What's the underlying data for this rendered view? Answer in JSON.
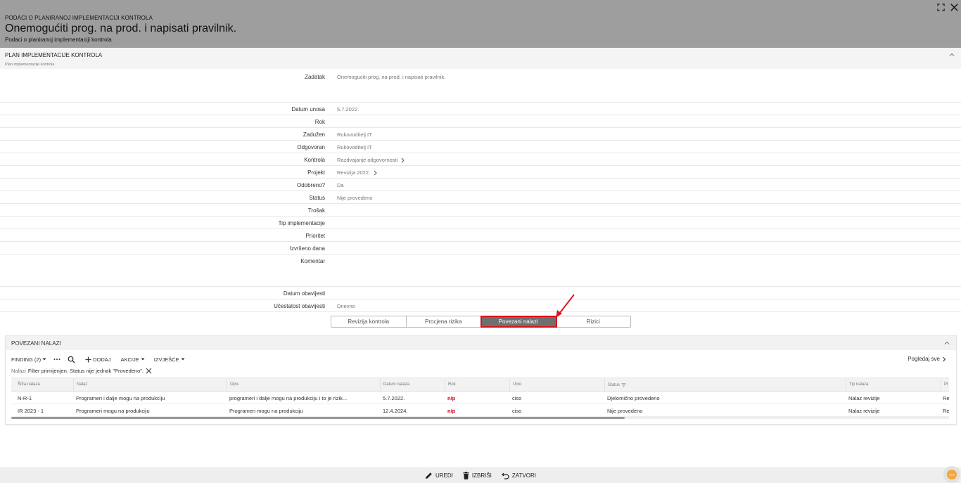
{
  "header": {
    "crumb": "PODACI O PLANIRANOJ IMPLEMENTACIJI KONTROLA",
    "title": "Onemogućiti prog. na prod. i napisati pravilnik.",
    "subtitle": "Podaci o planiranoj implementaciji kontrola"
  },
  "section": {
    "title": "PLAN IMPLEMENTACIJE KONTROLA",
    "subtitle": "Plan implementacije kontrola"
  },
  "form": {
    "fields": [
      {
        "label": "Zadatak",
        "value": "Onemogućiti prog. na prod. i napisati pravilnik."
      },
      {
        "label": "Datum unosa",
        "value": "5.7.2022."
      },
      {
        "label": "Rok",
        "value": ""
      },
      {
        "label": "Zadužen",
        "value": "Rukovoditelj IT"
      },
      {
        "label": "Odgovoran",
        "value": "Rukovoditelj IT"
      },
      {
        "label": "Kontrola",
        "value": "Razdvajanje odgovornosti"
      },
      {
        "label": "Projekt",
        "value": "Revizija 2022."
      },
      {
        "label": "Odobreno?",
        "value": "Da"
      },
      {
        "label": "Status",
        "value": "Nije provedeno"
      },
      {
        "label": "Trošak",
        "value": ""
      },
      {
        "label": "Tip implementacije",
        "value": ""
      },
      {
        "label": "Prioritet",
        "value": ""
      },
      {
        "label": "Izvršeno dana",
        "value": ""
      },
      {
        "label": "Komentar",
        "value": ""
      },
      {
        "label": "Datum obavijesti",
        "value": ""
      },
      {
        "label": "Učestalost obavijesti",
        "value": "Dnevno"
      }
    ]
  },
  "tabs": [
    {
      "label": "Revizija kontrola"
    },
    {
      "label": "Procjena rizika"
    },
    {
      "label": "Povezani nalazi",
      "active": true
    },
    {
      "label": "Rizici"
    }
  ],
  "panel": {
    "title": "POVEZANI NALAZI",
    "toolbar": {
      "finding": "FINDING (2)",
      "add": "DODAJ",
      "actions": "AKCIJE",
      "reports": "IZVJEŠĆE"
    },
    "view_all": "Pogledaj sve",
    "filter": {
      "prefix": "Nalazi",
      "text": "Filter primijenjen. Status nije jednak \"Provedeno\"."
    },
    "columns": [
      "Šifra nalaza",
      "Nalaz",
      "Opis",
      "Datum nalaza",
      "Rok",
      "Unio",
      "Status",
      "Tip nalaza",
      "Pr"
    ],
    "rows": [
      [
        "N-R-1",
        "Programeri i dalje mogu na produkciju",
        "programeri i dalje mogu na produkciju i to je rizik...",
        "5.7.2022.",
        "n/p",
        "ciso",
        "Djelomično provedeno",
        "Nalaz revizije",
        "Re"
      ],
      [
        "IR 2023 - 1",
        "Programeri mogu na produkciju",
        "Programeri mogu na produkciju",
        "12.4.2024.",
        "n/p",
        "ciso",
        "Nije provedeno",
        "Nalaz revizije",
        "Re"
      ]
    ]
  },
  "footer": {
    "edit": "UREDI",
    "delete": "IZBRIŠI",
    "close": "ZATVORI"
  },
  "colors": {
    "header_bg": "#9e9e9e",
    "active_tab_bg": "#6f6f6f",
    "highlight": "#d9111b",
    "deadline_red": "#d0021b",
    "chat_orange": "#f3a73b"
  }
}
